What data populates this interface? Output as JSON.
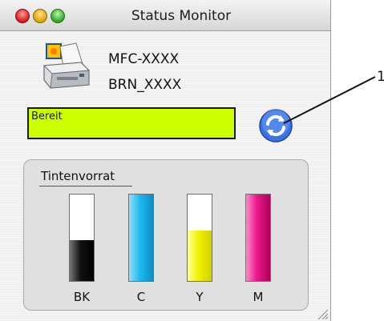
{
  "window": {
    "title": "Status Monitor"
  },
  "device": {
    "model": "MFC-XXXX",
    "node_name": "BRN_XXXX"
  },
  "status": {
    "text": "Bereit",
    "color": "#ccff00"
  },
  "ink": {
    "title": "Tintenvorrat",
    "tanks": [
      {
        "label": "BK",
        "color": "#1a1a1a",
        "level": 0.47
      },
      {
        "label": "C",
        "color": "#1fb8ef",
        "level": 1.0
      },
      {
        "label": "Y",
        "color": "#f2f200",
        "level": 0.58
      },
      {
        "label": "M",
        "color": "#e8178a",
        "level": 1.0
      }
    ]
  },
  "callout": {
    "number": "1"
  }
}
